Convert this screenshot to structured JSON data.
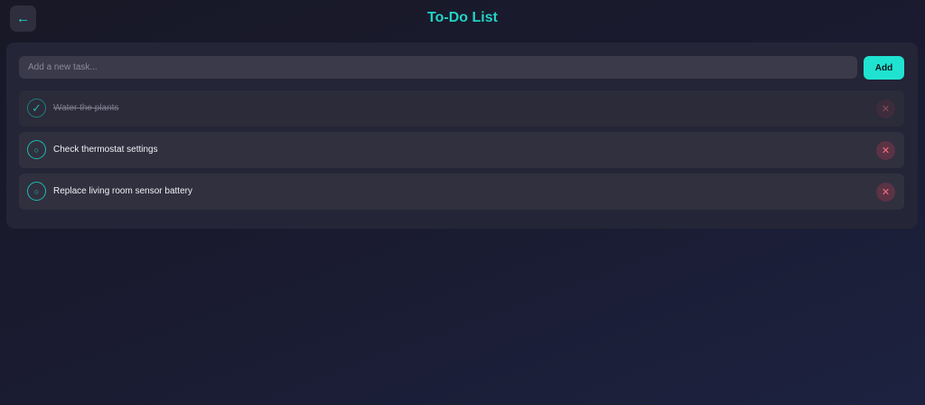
{
  "header": {
    "back_icon": "←",
    "title": "To-Do List"
  },
  "input": {
    "placeholder": "Add a new task...",
    "value": ""
  },
  "add_button": {
    "label": "Add"
  },
  "tasks": [
    {
      "text": "Water the plants",
      "completed": true,
      "status_icon": "✓",
      "delete_icon": "✕"
    },
    {
      "text": "Check thermostat settings",
      "completed": false,
      "status_icon": "○",
      "delete_icon": "✕"
    },
    {
      "text": "Replace living room sensor battery",
      "completed": false,
      "status_icon": "○",
      "delete_icon": "✕"
    }
  ],
  "colors": {
    "accent": "#22d3c5",
    "add_button_bg": "#1fe3d0",
    "panel_bg": "#242536",
    "delete_red": "#ff6f7f"
  }
}
